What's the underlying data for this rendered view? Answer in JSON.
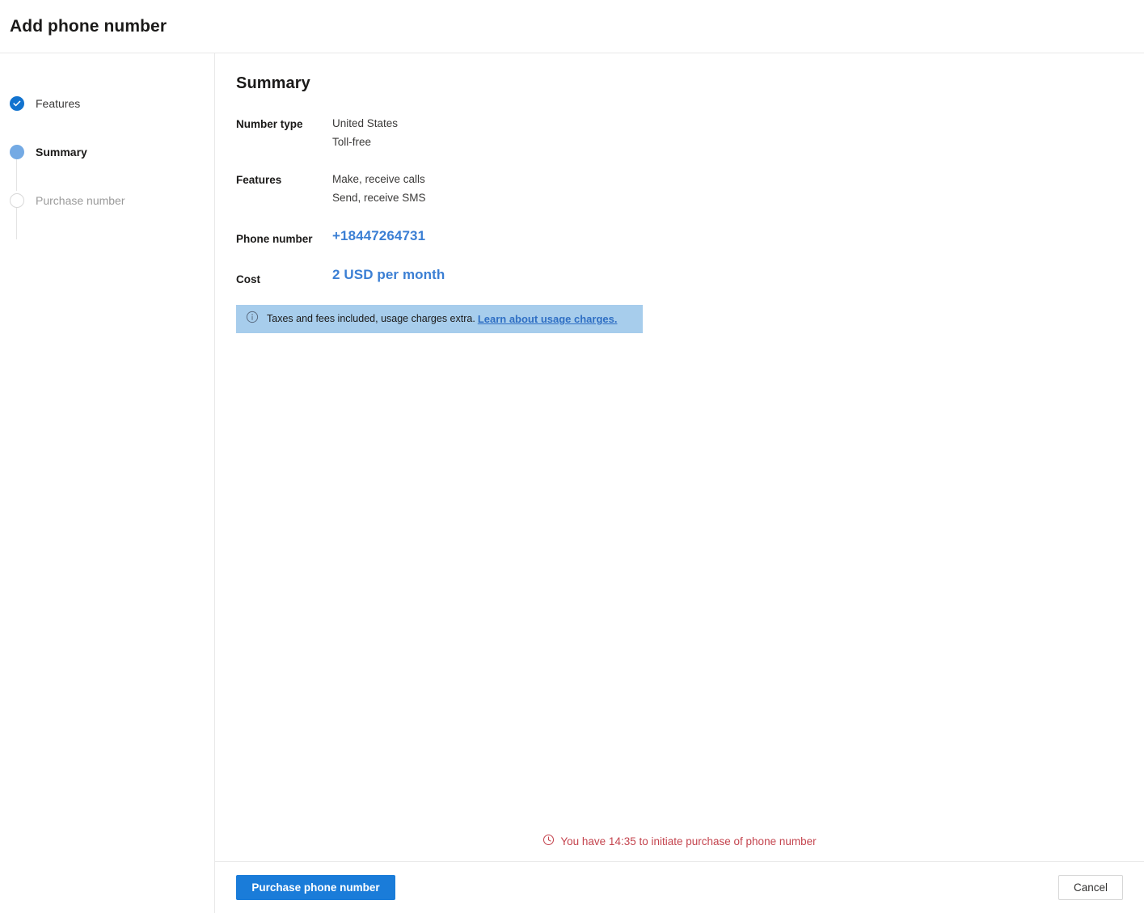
{
  "header": {
    "title": "Add phone number"
  },
  "wizard": {
    "steps": [
      {
        "label": "Features",
        "state": "done",
        "icon": "check-icon"
      },
      {
        "label": "Summary",
        "state": "current",
        "icon": "filled-circle-icon"
      },
      {
        "label": "Purchase number",
        "state": "todo",
        "icon": "empty-circle-icon"
      }
    ]
  },
  "main": {
    "section_title": "Summary",
    "rows": {
      "number_type": {
        "label": "Number type",
        "line1": "United States",
        "line2": "Toll-free"
      },
      "features": {
        "label": "Features",
        "line1": "Make, receive calls",
        "line2": "Send, receive SMS"
      },
      "phone_number": {
        "label": "Phone number",
        "value": "+18447264731"
      },
      "cost": {
        "label": "Cost",
        "value": "2 USD per month"
      }
    },
    "info_banner": {
      "icon": "info-circle-icon",
      "text": "Taxes and fees included, usage charges extra.",
      "link": "Learn about usage charges.",
      "background": "#a7cdec"
    },
    "timer": {
      "icon": "clock-icon",
      "text": "You have 14:35 to initiate purchase of phone number",
      "time_remaining": "14:35",
      "color": "#c4444e"
    }
  },
  "footer": {
    "primary_button": "Purchase phone number",
    "secondary_button": "Cancel",
    "accent": "#1a7cd9"
  }
}
